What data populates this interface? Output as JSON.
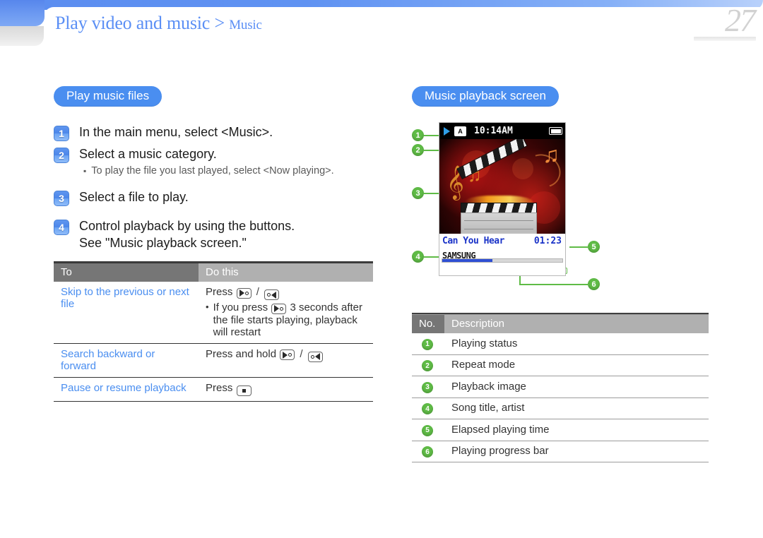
{
  "header": {
    "title_main": "Play video and music",
    "separator": ">",
    "title_sub": "Music",
    "page_number": "27",
    "brand_blue": "#5b8ff5"
  },
  "left": {
    "section_pill": "Play music files",
    "steps": [
      {
        "num": "1",
        "text": "In the main menu, select <Music>."
      },
      {
        "num": "2",
        "text": "Select a music category.",
        "note": "To play the file you last played, select <Now playing>."
      },
      {
        "num": "3",
        "text": "Select a file to play."
      },
      {
        "num": "4",
        "text": "Control playback by using the buttons.",
        "text2": "See \"Music playback screen.\""
      }
    ],
    "table": {
      "headers": [
        "To",
        "Do this"
      ],
      "rows": [
        {
          "to": "Skip to the previous or next file",
          "do_lead": "Press",
          "do_note_pre": "If you press",
          "do_note_post": "3 seconds after the file starts playing, playback will restart"
        },
        {
          "to": "Search backward or forward",
          "do_lead": "Press and hold"
        },
        {
          "to": "Pause or resume playback",
          "do_lead": "Press"
        }
      ]
    }
  },
  "right": {
    "section_pill": "Music playback screen",
    "player": {
      "status_repeat_letter": "A",
      "clock": "10:14AM",
      "song_title": "Can You Hear",
      "artist": "SAMSUNG",
      "elapsed_time": "01:23",
      "progress_percent": 42
    },
    "callouts": [
      "1",
      "2",
      "3",
      "4",
      "5",
      "6"
    ],
    "table": {
      "headers": [
        "No.",
        "Description"
      ],
      "rows": [
        {
          "no": "1",
          "desc": "Playing status"
        },
        {
          "no": "2",
          "desc": "Repeat mode"
        },
        {
          "no": "3",
          "desc": "Playback image"
        },
        {
          "no": "4",
          "desc": "Song title, artist"
        },
        {
          "no": "5",
          "desc": "Elapsed playing time"
        },
        {
          "no": "6",
          "desc": "Playing progress bar"
        }
      ]
    }
  },
  "icons": {
    "skip_next": "skip-next-key-icon",
    "skip_prev": "skip-prev-key-icon",
    "play_pause": "play-pause-key-icon"
  }
}
